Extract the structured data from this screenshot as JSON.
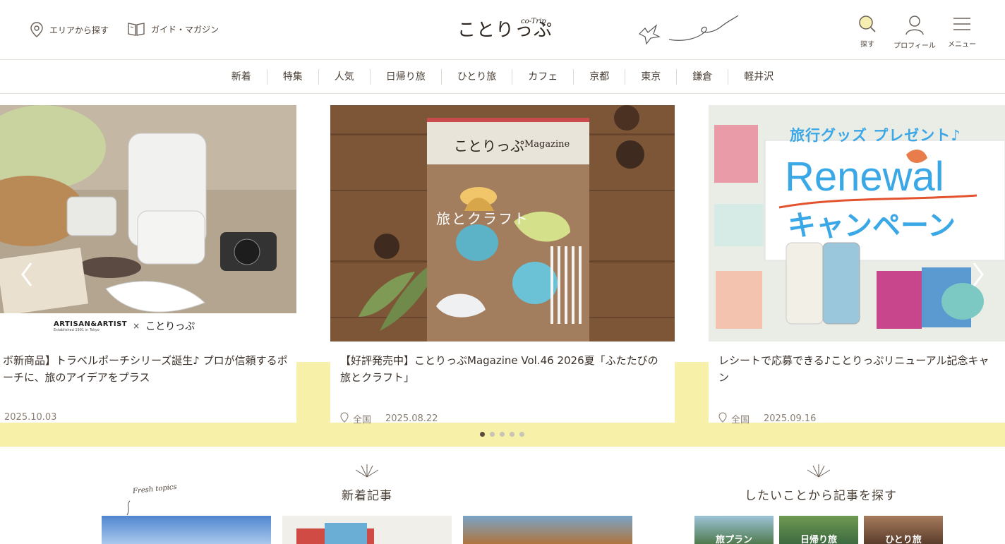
{
  "header": {
    "area_search": "エリアから探す",
    "guide_magazine": "ガイド・マガジン",
    "logo": "ことりっぷ",
    "logo_sub": "co-Trip",
    "search_label": "探す",
    "profile_label": "プロフィール",
    "menu_label": "メニュー"
  },
  "categories": [
    "新着",
    "特集",
    "人気",
    "日帰り旅",
    "ひとり旅",
    "カフェ",
    "京都",
    "東京",
    "鎌倉",
    "軽井沢"
  ],
  "carousel": {
    "cards": [
      {
        "title": "ボ新商品】トラベルポーチシリーズ誕生♪ プロが信頼するポーチに、旅のアイデアをプラス",
        "area": "",
        "date": "2025.10.03",
        "brand_left": "ARTISAN&ARTIST",
        "brand_left_sub": "Established 1991 in Tokyo",
        "brand_times": "×",
        "brand_right": "ことりっぷ"
      },
      {
        "title": "【好評発売中】ことりっぷMagazine Vol.46 2026夏「ふたたびの旅とクラフト」",
        "area": "全国",
        "date": "2025.08.22",
        "mag_title": "ことりっぷ",
        "mag_sub": "Magazine",
        "mag_cover_text": "旅とクラフト"
      },
      {
        "title": "レシートで応募できる♪ことりっぷリニューアル記念キャン",
        "area": "全国",
        "date": "2025.09.16",
        "promo_top": "旅行グッズ プレゼント♪",
        "promo_main": "Renewal",
        "promo_sub": "キャンペーン"
      }
    ],
    "active_dot": 0,
    "dot_count": 5
  },
  "sections": {
    "new_articles": "新着記事",
    "fresh_topics": "Fresh topics",
    "find_by_activity": "したいことから記事を探す",
    "activity_thumbs": [
      "旅プラン",
      "日帰り旅",
      "ひとり旅"
    ]
  },
  "colors": {
    "accent_yellow": "#f7f0a8",
    "text": "#4a3f35",
    "promo_blue": "#3aa7e6"
  }
}
